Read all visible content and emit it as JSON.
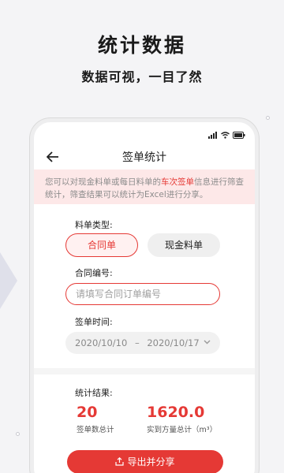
{
  "promo": {
    "headline": "统计数据",
    "subline": "数据可视，一目了然"
  },
  "status_bar": {
    "icons": [
      "signal-icon",
      "wifi-icon",
      "battery-icon"
    ]
  },
  "header": {
    "back_icon": "arrow-left-icon",
    "title": "签单统计"
  },
  "notice": {
    "text_before": "您可以对现金料单或每日料单的",
    "highlight": "车次签单",
    "text_after": "信息进行筛查统计，筛查结果可以统计为Excel进行分享。",
    "highlight_color": "#e53935"
  },
  "form": {
    "type_label": "料单类型:",
    "type_options": [
      {
        "label": "合同单",
        "selected": true
      },
      {
        "label": "现金料单",
        "selected": false
      }
    ],
    "contract_label": "合同编号:",
    "contract_value": "",
    "contract_placeholder": "请填写合同订单编号",
    "date_label": "签单时间:",
    "date_start": "2020/10/10",
    "date_sep": "–",
    "date_end": "2020/10/17",
    "date_chevron": "chevron-down-icon"
  },
  "results": {
    "label": "统计结果:",
    "count_value": "20",
    "count_caption": "签单数总计",
    "volume_value": "1620.0",
    "volume_caption": "实到方量总计（m³）"
  },
  "export": {
    "icon": "share-icon",
    "label": "导出并分享"
  },
  "colors": {
    "accent": "#e53935",
    "notice_bg": "#fde8e8"
  }
}
